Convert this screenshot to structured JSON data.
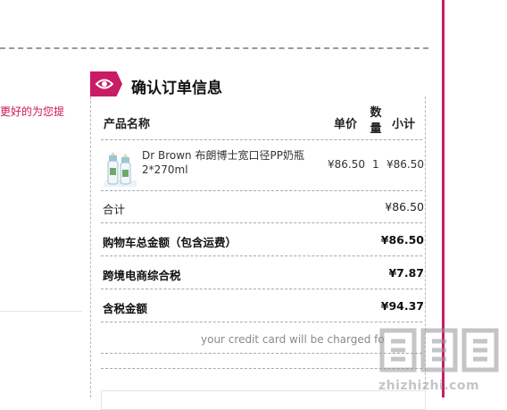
{
  "left": {
    "note": "更好的为您提"
  },
  "section": {
    "title": "确认订单信息",
    "icon": "eye-icon"
  },
  "table": {
    "headers": {
      "name": "产品名称",
      "price": "单价",
      "qty": "数量",
      "subtotal": "小计"
    },
    "items": [
      {
        "name": "Dr Brown 布朗博士宽口径PP奶瓶2*270ml",
        "price": "¥86.50",
        "qty": "1",
        "subtotal": "¥86.50"
      }
    ]
  },
  "summary": {
    "subtotal_label": "合计",
    "subtotal_value": "¥86.50",
    "cart_total_label": "购物车总金额（包含运费）",
    "cart_total_value": "¥86.50",
    "tax_label": "跨境电商综合税",
    "tax_value": "¥7.87",
    "total_label": "含税金额",
    "total_value": "¥94.37",
    "charge_note": "your credit card will be charged fo"
  },
  "watermark": {
    "logo": "值值值",
    "text": "zhizhizhi.com"
  },
  "colors": {
    "accent": "#c81c64",
    "dash": "#a8a8a8"
  }
}
